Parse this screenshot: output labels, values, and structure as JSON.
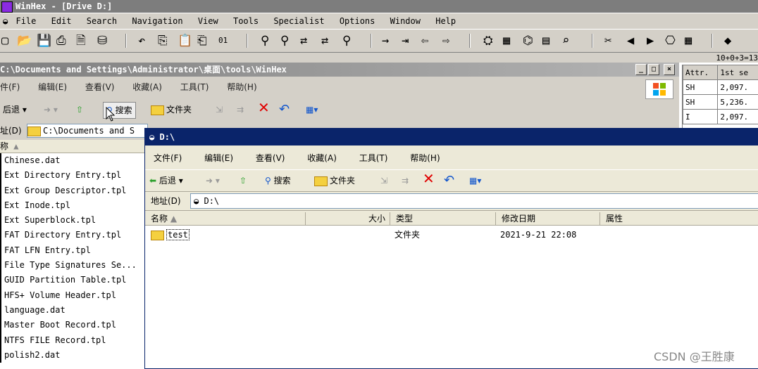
{
  "winhex": {
    "title": "WinHex - [Drive D:]",
    "menu": [
      "File",
      "Edit",
      "Search",
      "Navigation",
      "View",
      "Tools",
      "Specialist",
      "Options",
      "Window",
      "Help"
    ],
    "topright_text": "10+0+3=13"
  },
  "side_table": {
    "headers": [
      "Attr.",
      "1st se"
    ],
    "rows": [
      [
        "SH",
        "2,097."
      ],
      [
        "SH",
        "5,236."
      ],
      [
        "I",
        "2,097."
      ]
    ]
  },
  "explorer_back": {
    "title": "C:\\Documents and Settings\\Administrator\\桌面\\tools\\WinHex",
    "menu": [
      "件(F)",
      "编辑(E)",
      "查看(V)",
      "收藏(A)",
      "工具(T)",
      "帮助(H)"
    ],
    "toolbar": {
      "back": "后退",
      "search": "搜索",
      "folders": "文件夹"
    },
    "address_label": "址(D)",
    "address_value": "C:\\Documents and S",
    "list_header": "称",
    "files": [
      "Chinese.dat",
      "Ext Directory Entry.tpl",
      "Ext Group Descriptor.tpl",
      "Ext Inode.tpl",
      "Ext Superblock.tpl",
      "FAT Directory Entry.tpl",
      "FAT LFN Entry.tpl",
      "File Type Signatures Se...",
      "GUID Partition Table.tpl",
      "HFS+ Volume Header.tpl",
      "language.dat",
      "Master Boot Record.tpl",
      "NTFS FILE Record.tpl",
      "polish2.dat"
    ]
  },
  "explorer_front": {
    "title": "D:\\",
    "menu": [
      "文件(F)",
      "编辑(E)",
      "查看(V)",
      "收藏(A)",
      "工具(T)",
      "帮助(H)"
    ],
    "toolbar": {
      "back": "后退",
      "search": "搜索",
      "folders": "文件夹"
    },
    "address_label": "地址(D)",
    "address_value": "D:\\",
    "columns": {
      "name": "名称",
      "size": "大小",
      "type": "类型",
      "modified": "修改日期",
      "attr": "属性"
    },
    "rows": [
      {
        "name": "test",
        "type": "文件夹",
        "modified": "2021-9-21 22:08"
      }
    ]
  },
  "watermark": "CSDN @王胜康"
}
